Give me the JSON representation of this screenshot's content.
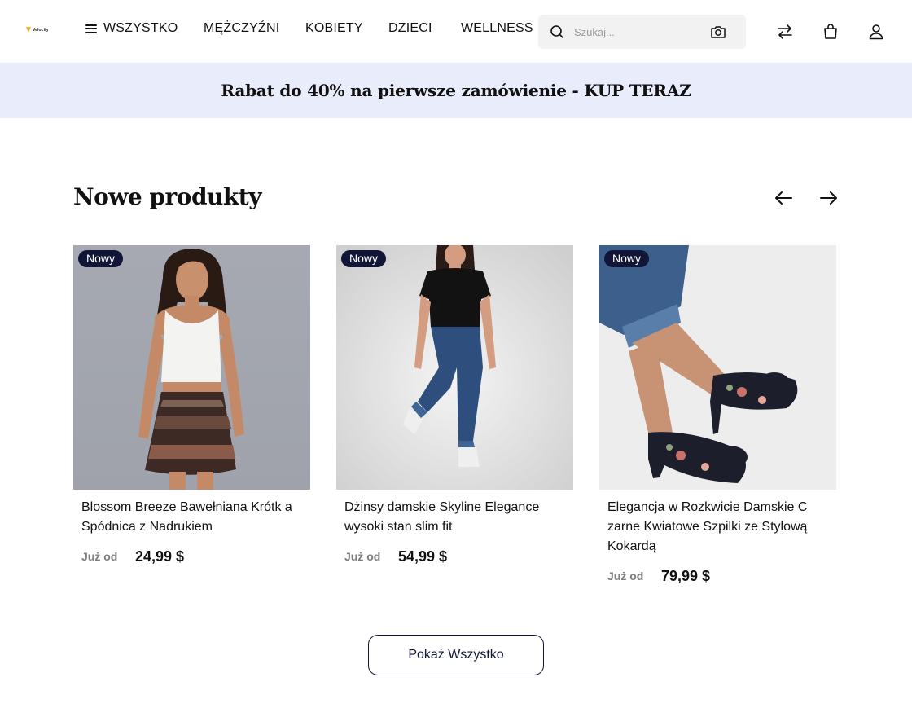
{
  "header": {
    "logo_text": "Velocity",
    "nav": [
      {
        "label": "WSZYSTKO"
      },
      {
        "label": "MĘŻCZYŹNI"
      },
      {
        "label": "KOBIETY"
      },
      {
        "label": "DZIECI"
      },
      {
        "label": "WELLNESS"
      }
    ],
    "search": {
      "placeholder": "Szukaj...",
      "value": ""
    },
    "icons": [
      "search-icon",
      "camera-icon",
      "compare-icon",
      "shopping-bag-icon",
      "user-icon"
    ]
  },
  "promo": {
    "text": "Rabat do 40% na pierwsze zamówienie - KUP TERAZ"
  },
  "section": {
    "title": "Nowe produkty",
    "prev_icon": "arrow-left-icon",
    "next_icon": "arrow-right-icon"
  },
  "products": [
    {
      "badge": "Nowy",
      "name": "Blossom Breeze Bawełniana Krótk a Spódnica z Nadrukiem",
      "from": "Już od",
      "price": "24,99 $"
    },
    {
      "badge": "Nowy",
      "name": "Dżinsy damskie Skyline Elegance wysoki stan slim fit",
      "from": "Już od",
      "price": "54,99 $"
    },
    {
      "badge": "Nowy",
      "name": "Elegancja w Rozkwicie Damskie C zarne Kwiatowe Szpilki ze Stylową Kokardą",
      "from": "Już od",
      "price": "79,99 $"
    }
  ],
  "show_all_label": "Pokaż Wszystko",
  "colors": {
    "promo_bg": "#e8ecfb",
    "badge_bg": "#111536",
    "accent": "#111536"
  }
}
